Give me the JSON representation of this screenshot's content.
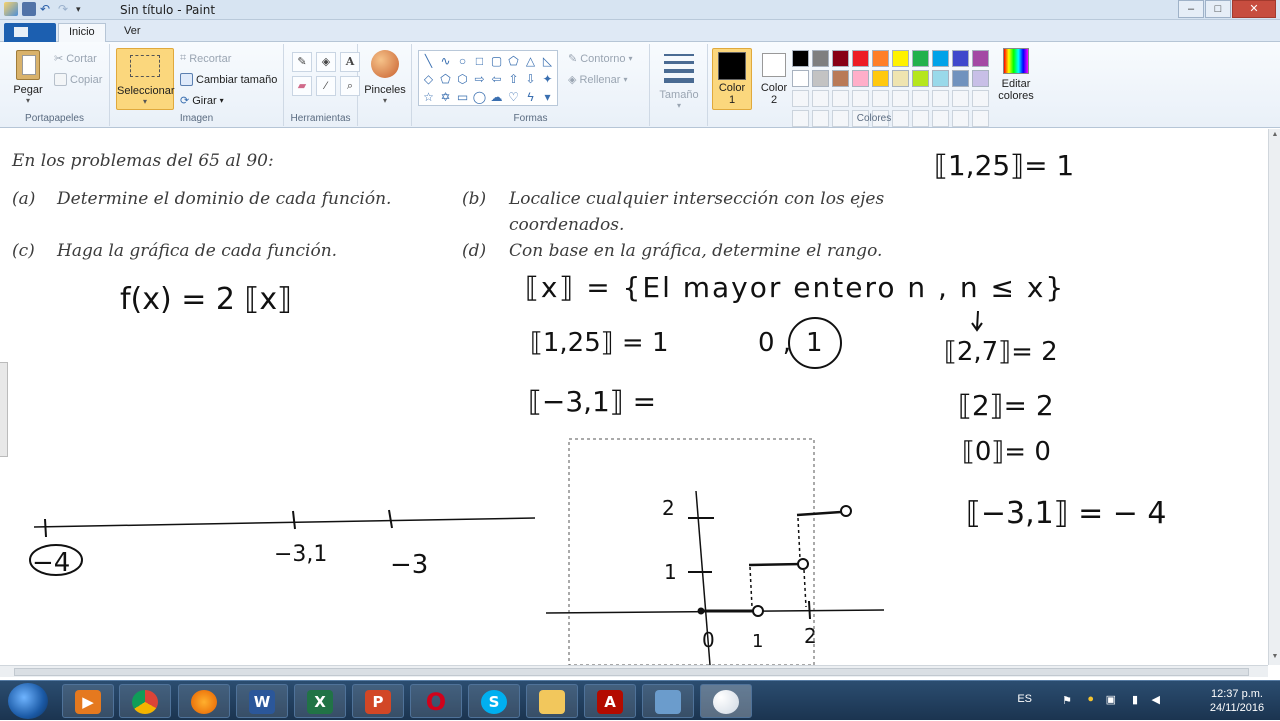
{
  "window": {
    "title": "Sin título - Paint",
    "controls": {
      "minimize": "‒",
      "maximize": "□",
      "close": "✕"
    }
  },
  "tabs": {
    "file": "",
    "inicio": "Inicio",
    "ver": "Ver"
  },
  "ribbon": {
    "portapapeles": {
      "label": "Portapapeles",
      "paste": "Pegar",
      "cut": "Cortar",
      "copy": "Copiar"
    },
    "imagen": {
      "label": "Imagen",
      "select": "Seleccionar",
      "crop": "Recortar",
      "resize": "Cambiar tamaño",
      "rotate": "Girar"
    },
    "herramientas": {
      "label": "Herramientas"
    },
    "pinceles": {
      "label": "Pinceles"
    },
    "formas": {
      "label": "Formas",
      "outline": "Contorno",
      "fill": "Rellenar"
    },
    "tamano": {
      "label": "Tamaño"
    },
    "colores": {
      "label": "Colores",
      "color1": "Color",
      "color1_num": "1",
      "color2": "Color",
      "color2_num": "2",
      "edit": "Editar",
      "edit2": "colores",
      "palette_row1": [
        "#000000",
        "#7f7f7f",
        "#880015",
        "#ed1c24",
        "#ff7f27",
        "#fff200",
        "#22b14c",
        "#00a2e8",
        "#3f48cc",
        "#a349a4"
      ],
      "palette_row2": [
        "#ffffff",
        "#c3c3c3",
        "#b97a57",
        "#ffaec9",
        "#ffc90e",
        "#efe4b0",
        "#b5e61d",
        "#99d9ea",
        "#7092be",
        "#c8bfe7"
      ]
    }
  },
  "document": {
    "intro": "En  los problemas del 65 al 90:",
    "a_label": "(a)",
    "a_text": "Determine el dominio de cada función.",
    "b_label": "(b)",
    "b_text": "Localice cualquier intersección con los ejes",
    "b_text2": "coordenados.",
    "c_label": "(c)",
    "c_text": "Haga la gráfica de cada función.",
    "d_label": "(d)",
    "d_text": "Con base en la gráfica, determine el rango."
  },
  "handwriting": {
    "top_right": "⟦1,25⟧= 1",
    "function": "f(x) = 2 ⟦x⟧",
    "definition": "⟦x⟧ = {El mayor entero n , n ≤ x}",
    "ex1": "⟦1,25⟧ = 1",
    "options": "0 ,",
    "circled_one": "1",
    "ex2": "⟦−3,1⟧ =",
    "r1": "⟦2,7⟧= 2",
    "r2": "⟦2⟧= 2",
    "r3": "⟦0⟧= 0",
    "r4": "⟦−3,1⟧ = − 4",
    "nl_minus4": "−4",
    "nl_minus31": "−3,1",
    "nl_minus3": "−3",
    "g_y2": "2",
    "g_y1": "1",
    "g_x0": "0",
    "g_x1": "1",
    "g_x2": "2"
  },
  "taskbar": {
    "lang": "ES",
    "time": "12:37 p.m.",
    "date": "24/11/2016"
  },
  "colors": {
    "accent": "#1c5fb0",
    "selected_tool": "#f9d77a",
    "ink": "#111111",
    "opera": "#d0021b",
    "skype": "#00aff0",
    "word": "#2b579a",
    "excel": "#217346",
    "ppt": "#d24726"
  }
}
